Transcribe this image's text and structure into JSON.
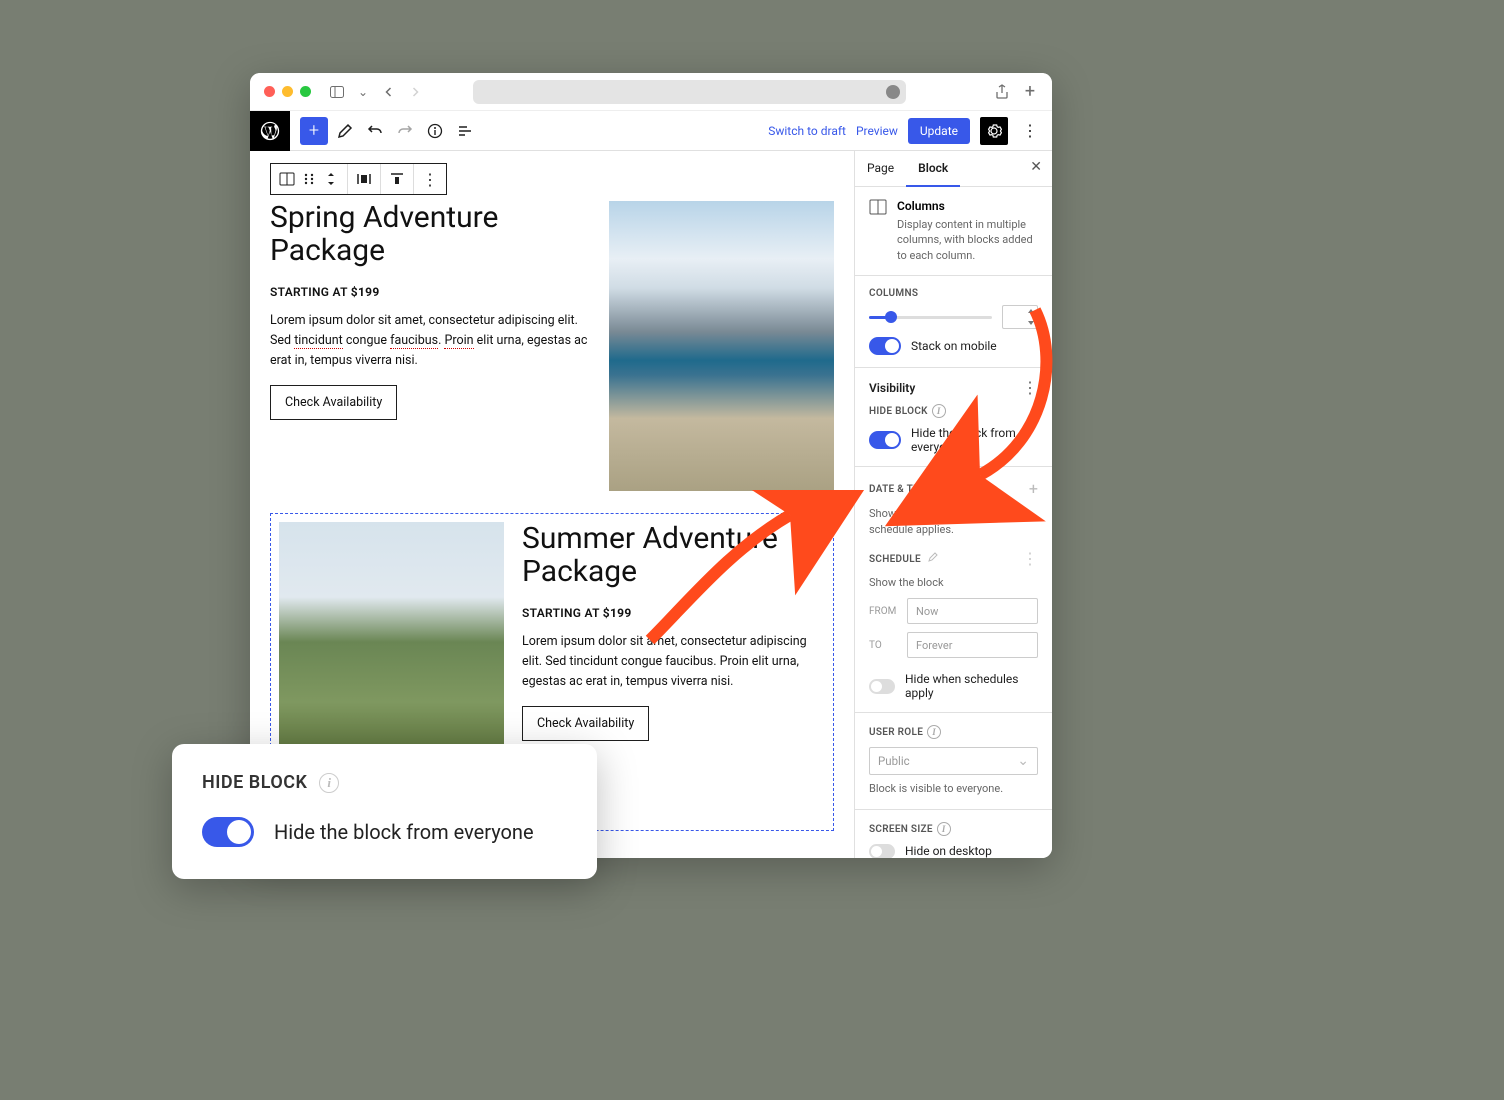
{
  "topbar": {
    "switch_to_draft": "Switch to draft",
    "preview": "Preview",
    "update": "Update"
  },
  "canvas": {
    "pkg1": {
      "title": "Spring Adventure Package",
      "start_label": "STARTING AT ",
      "price": "$199",
      "body_a": "Lorem ipsum dolor sit amet, consectetur adipiscing elit. Sed ",
      "body_u1": "tincidunt",
      "body_b": " congue ",
      "body_u2": "faucibus",
      "body_c": ". ",
      "body_u3": "Proin",
      "body_d": " elit urna, egestas ac erat in, tempus viverra nisi.",
      "cta": "Check Availability"
    },
    "pkg2": {
      "title": "Summer Adventure Package",
      "start_label": "STARTING AT ",
      "price": "$199",
      "body": "Lorem ipsum dolor sit amet, consectetur adipiscing elit. Sed tincidunt congue faucibus. Proin elit urna, egestas ac erat in, tempus viverra nisi.",
      "cta": "Check Availability"
    }
  },
  "sidebar": {
    "tab_page": "Page",
    "tab_block": "Block",
    "block_name": "Columns",
    "block_desc": "Display content in multiple columns, with blocks added to each column.",
    "columns_label": "COLUMNS",
    "stack_label": "Stack on mobile",
    "visibility_title": "Visibility",
    "hide_block_label": "HIDE BLOCK",
    "hide_block_toggle": "Hide the block from everyone",
    "date_time_label": "DATE & TIME",
    "date_time_desc": "Show the block if at least one schedule applies.",
    "schedule_label": "SCHEDULE",
    "schedule_desc": "Show the block",
    "from_label": "FROM",
    "from_placeholder": "Now",
    "to_label": "TO",
    "to_placeholder": "Forever",
    "hide_schedules": "Hide when schedules apply",
    "user_role_label": "USER ROLE",
    "user_role_value": "Public",
    "user_role_desc": "Block is visible to everyone.",
    "screen_size_label": "SCREEN SIZE",
    "hide_desktop": "Hide on desktop"
  },
  "callout": {
    "title": "HIDE BLOCK",
    "text": "Hide the block from everyone"
  }
}
